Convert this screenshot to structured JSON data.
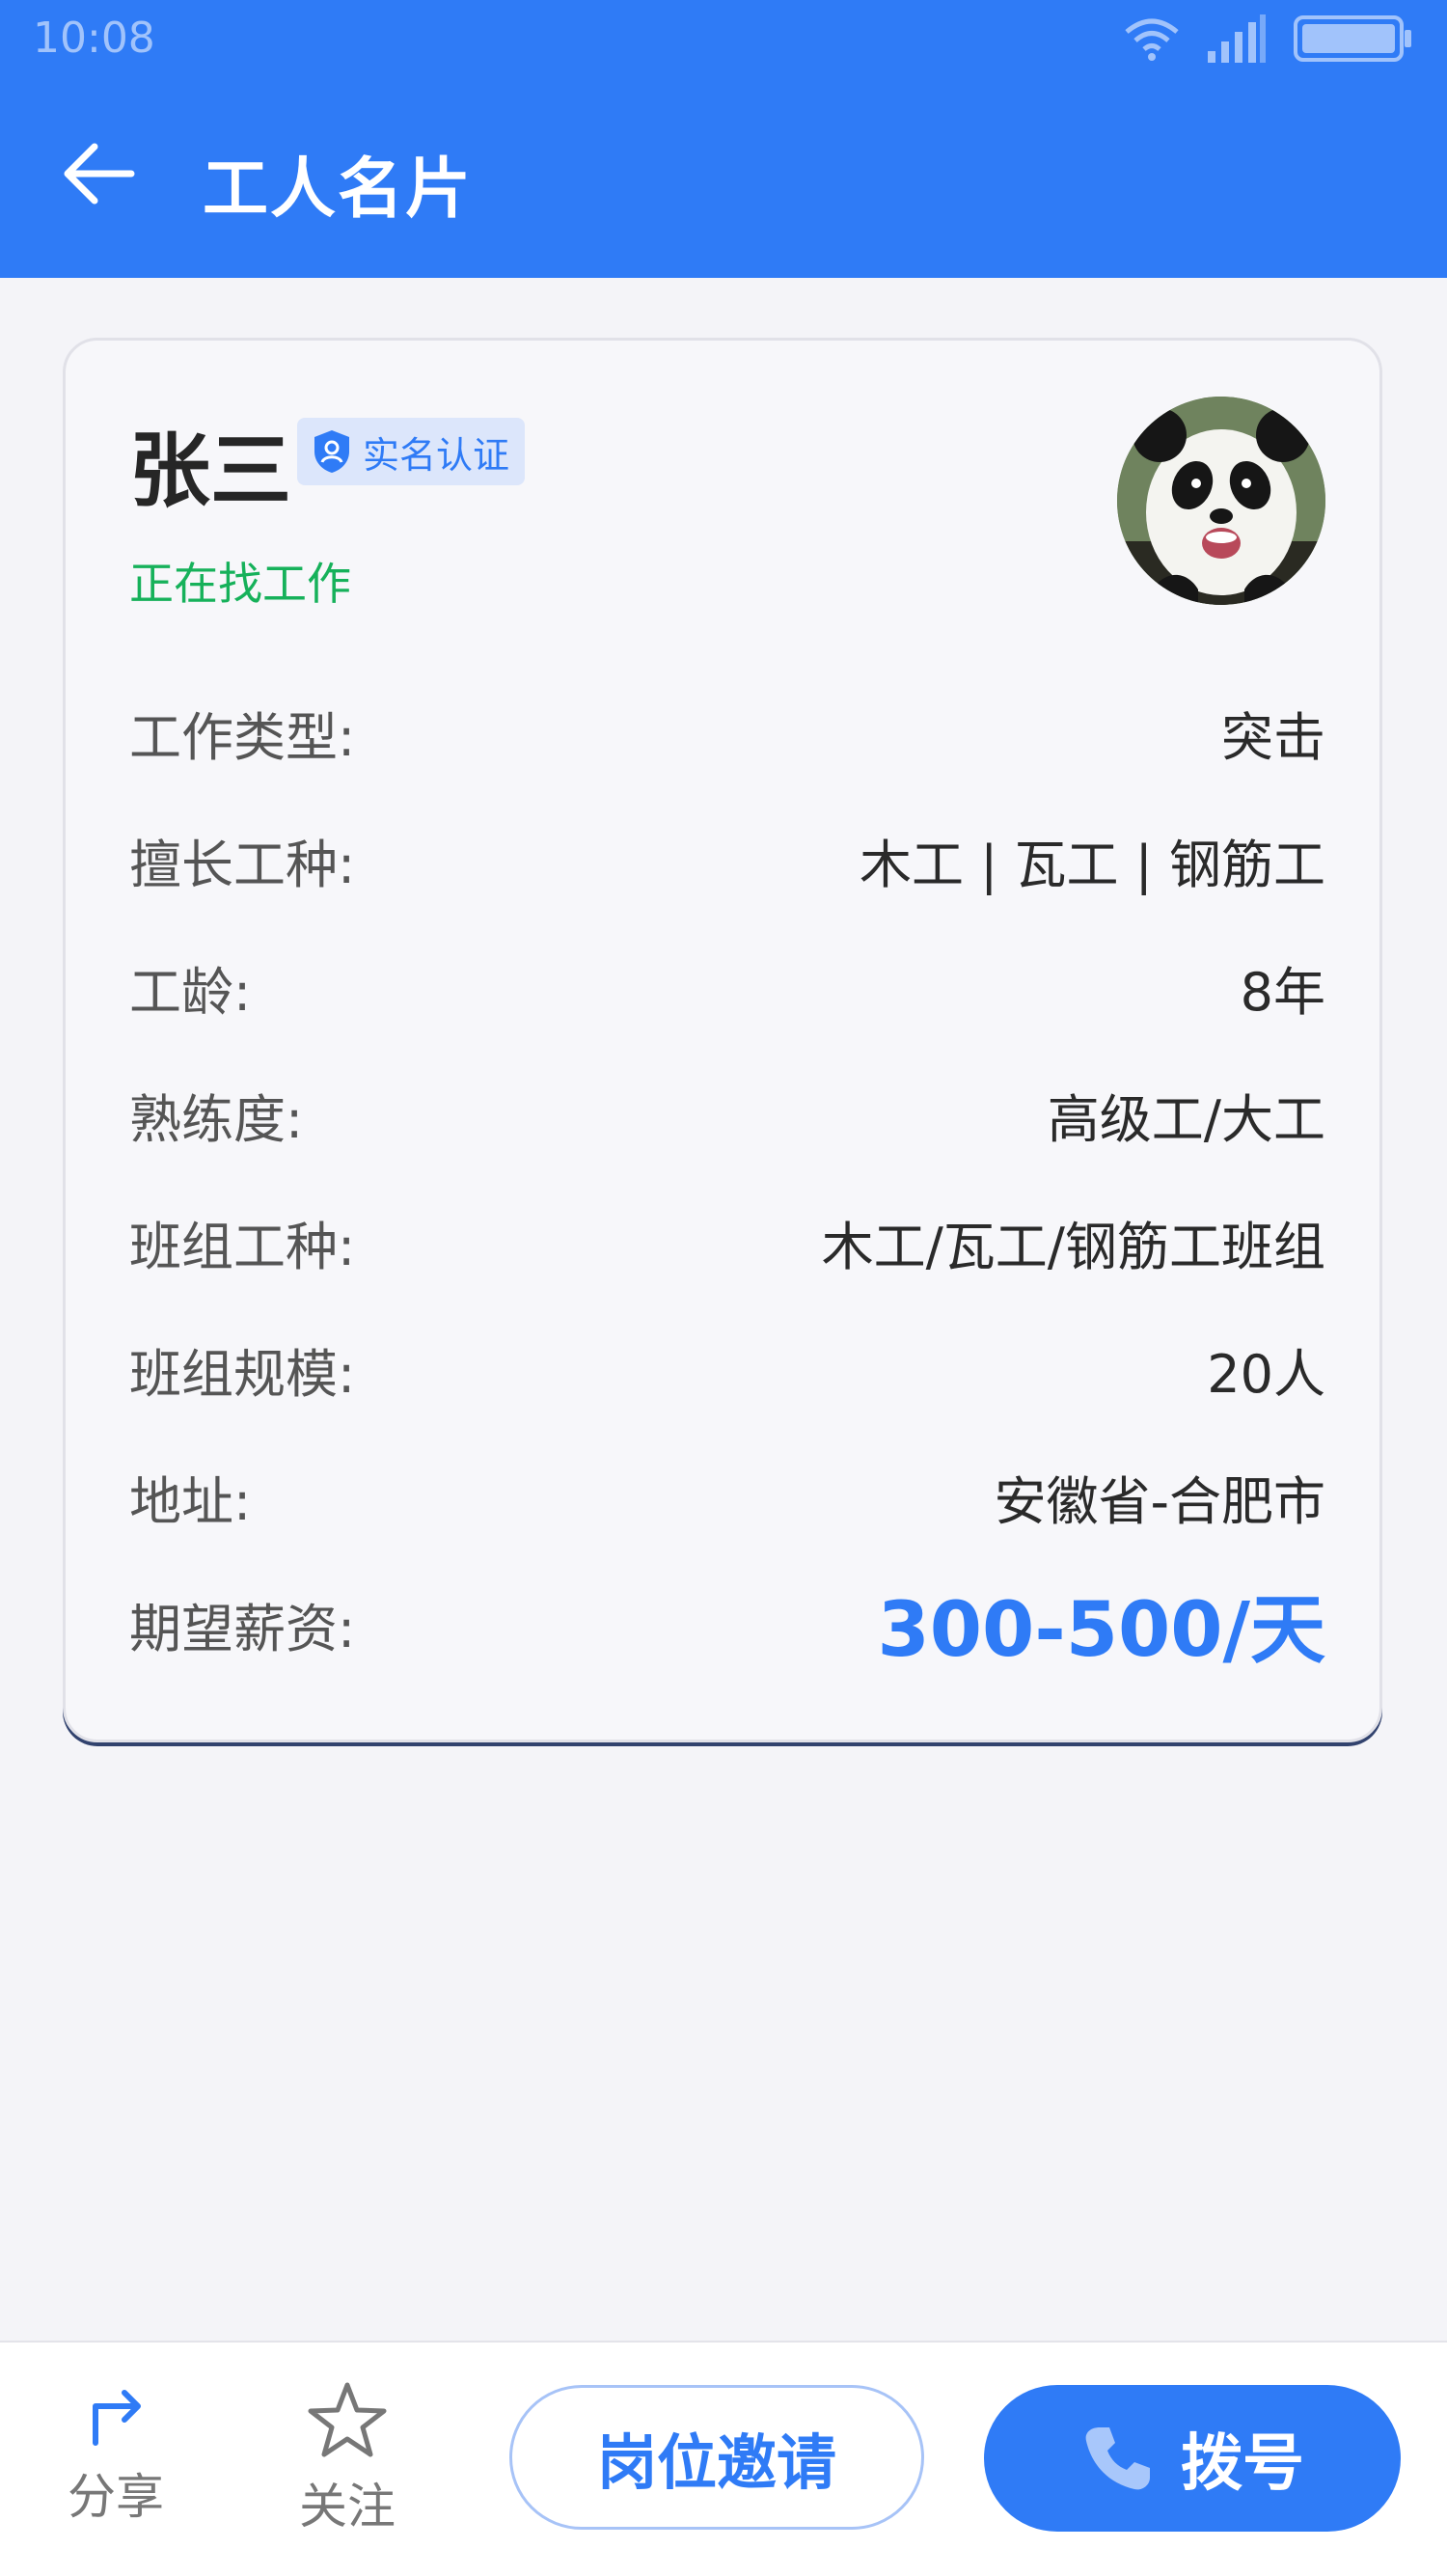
{
  "status_bar": {
    "time": "10:08"
  },
  "header": {
    "title": "工人名片"
  },
  "profile": {
    "name": "张三",
    "verified_label": "实名认证",
    "status": "正在找工作",
    "avatar_icon": "panda-avatar"
  },
  "details": [
    {
      "label": "工作类型:",
      "value": "突击"
    },
    {
      "label": "擅长工种:",
      "value": "木工 | 瓦工 | 钢筋工"
    },
    {
      "label": "工龄:",
      "value": "8年"
    },
    {
      "label": "熟练度:",
      "value": "高级工/大工"
    },
    {
      "label": "班组工种:",
      "value": "木工/瓦工/钢筋工班组"
    },
    {
      "label": "班组规模:",
      "value": "20人"
    },
    {
      "label": "地址:",
      "value": "安徽省-合肥市"
    },
    {
      "label": "期望薪资:",
      "value": "300-500/天"
    }
  ],
  "bottom_bar": {
    "share_label": "分享",
    "follow_label": "关注",
    "invite_label": "岗位邀请",
    "call_label": "拨号"
  },
  "colors": {
    "primary": "#2f7bf6",
    "status_green": "#16b15a",
    "badge_bg": "#dce6fb"
  }
}
